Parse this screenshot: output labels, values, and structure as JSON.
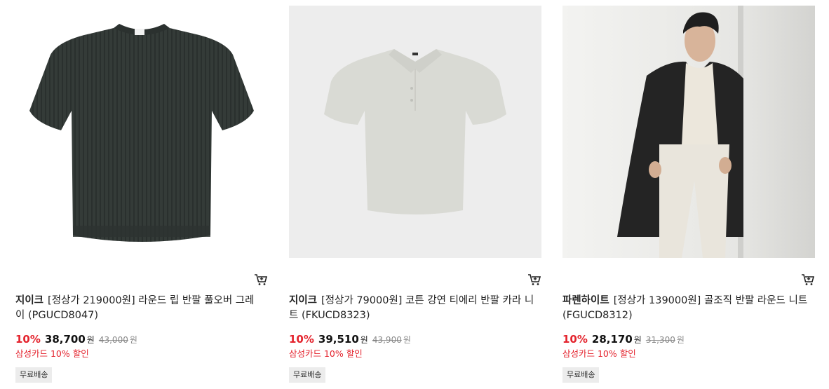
{
  "products": [
    {
      "brand": "지이크",
      "title_line1": "[정상가 219000원] 라운드 립 반팔 풀오버 그레",
      "title_line2": "이 (PGUCD8047)",
      "discount_rate": "10%",
      "sale_price": "38,700",
      "price_unit": "원",
      "original_price": "43,000",
      "card_promo": "삼성카드 10% 할인",
      "shipping_badge": "무료배송",
      "image_icon": "dark-knit-tshirt-image",
      "image_color": "#343b38"
    },
    {
      "brand": "지이크",
      "title_line1": "[정상가 79000원] 코튼 강연 티에리 반팔 카라 니",
      "title_line2": "트 (FKUCD8323)",
      "discount_rate": "10%",
      "sale_price": "39,510",
      "price_unit": "원",
      "original_price": "43,900",
      "card_promo": "삼성카드 10% 할인",
      "shipping_badge": "무료배송",
      "image_icon": "light-polo-knit-image",
      "image_color": "#d9dad4"
    },
    {
      "brand": "파렌하이트",
      "title_line1": "[정상가 139000원] 골조직 반팔 라운드 니트",
      "title_line2": "(FGUCD8312)",
      "discount_rate": "10%",
      "sale_price": "28,170",
      "price_unit": "원",
      "original_price": "31,300",
      "card_promo": "삼성카드 10% 할인",
      "shipping_badge": "무료배송",
      "image_icon": "model-coat-photo-image",
      "image_color": "#ece8df"
    }
  ],
  "colors": {
    "discount": "#e4232d",
    "badge_bg": "#ececec"
  }
}
